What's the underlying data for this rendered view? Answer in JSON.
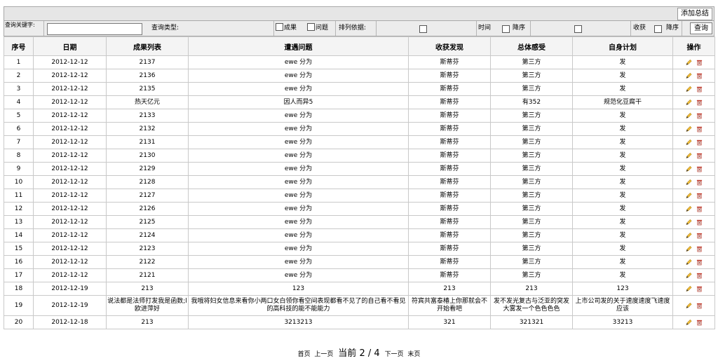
{
  "toolbar": {
    "add_summary": "添加总结"
  },
  "query": {
    "keyword_label": "查询关键字:",
    "keyword_value": "",
    "type_label": "查询类型:",
    "opt_result": "成果",
    "opt_problem": "问题",
    "sort_label": "排列依据:",
    "time_label": "时间",
    "desc_label": "降序",
    "gain_label": "收获",
    "desc_label2": "降序",
    "search_button": "查询"
  },
  "table": {
    "headers": [
      "序号",
      "日期",
      "成果列表",
      "遭遇问题",
      "收获发现",
      "总体感受",
      "自身计划",
      "操作"
    ],
    "rows": [
      [
        "1",
        "2012-12-12",
        "2137",
        "ewe 分为",
        "斯蒂芬",
        "第三方",
        "发"
      ],
      [
        "2",
        "2012-12-12",
        "2136",
        "ewe 分为",
        "斯蒂芬",
        "第三方",
        "发"
      ],
      [
        "3",
        "2012-12-12",
        "2135",
        "ewe 分为",
        "斯蒂芬",
        "第三方",
        "发"
      ],
      [
        "4",
        "2012-12-12",
        "热天亿元",
        "因人而异5",
        "斯蒂芬",
        "有352",
        "规范化豆腐干"
      ],
      [
        "5",
        "2012-12-12",
        "2133",
        "ewe 分为",
        "斯蒂芬",
        "第三方",
        "发"
      ],
      [
        "6",
        "2012-12-12",
        "2132",
        "ewe 分为",
        "斯蒂芬",
        "第三方",
        "发"
      ],
      [
        "7",
        "2012-12-12",
        "2131",
        "ewe 分为",
        "斯蒂芬",
        "第三方",
        "发"
      ],
      [
        "8",
        "2012-12-12",
        "2130",
        "ewe 分为",
        "斯蒂芬",
        "第三方",
        "发"
      ],
      [
        "9",
        "2012-12-12",
        "2129",
        "ewe 分为",
        "斯蒂芬",
        "第三方",
        "发"
      ],
      [
        "10",
        "2012-12-12",
        "2128",
        "ewe 分为",
        "斯蒂芬",
        "第三方",
        "发"
      ],
      [
        "11",
        "2012-12-12",
        "2127",
        "ewe 分为",
        "斯蒂芬",
        "第三方",
        "发"
      ],
      [
        "12",
        "2012-12-12",
        "2126",
        "ewe 分为",
        "斯蒂芬",
        "第三方",
        "发"
      ],
      [
        "13",
        "2012-12-12",
        "2125",
        "ewe 分为",
        "斯蒂芬",
        "第三方",
        "发"
      ],
      [
        "14",
        "2012-12-12",
        "2124",
        "ewe 分为",
        "斯蒂芬",
        "第三方",
        "发"
      ],
      [
        "15",
        "2012-12-12",
        "2123",
        "ewe 分为",
        "斯蒂芬",
        "第三方",
        "发"
      ],
      [
        "16",
        "2012-12-12",
        "2122",
        "ewe 分为",
        "斯蒂芬",
        "第三方",
        "发"
      ],
      [
        "17",
        "2012-12-12",
        "2121",
        "ewe 分为",
        "斯蒂芬",
        "第三方",
        "发"
      ],
      [
        "18",
        "2012-12-19",
        "213",
        "123",
        "213",
        "213",
        "123"
      ],
      [
        "19",
        "2012-12-19",
        "说法都是法师打发我是函数;l欧进萍好",
        "我哦将妇女信息来看你小两口女白领你看空间表现都看不见了的自己看不看见的高科技的能不能能力",
        "符宾共富泰椿上你那就会不开始看吧",
        "发不发光复古与泛亚的突发大雾发一个色色色色",
        "上市公司发的关于速度速度飞速度应该"
      ],
      [
        "20",
        "2012-12-18",
        "213",
        "3213213",
        "321",
        "321321",
        "33213"
      ]
    ]
  },
  "pager": {
    "first": "首页",
    "prev": "上一页",
    "current_label": "当前",
    "current": "2",
    "slash": "/",
    "total": "4",
    "next": "下一页",
    "last": "末页"
  },
  "icons": {
    "edit": "pencil-icon",
    "delete": "trash-icon"
  }
}
